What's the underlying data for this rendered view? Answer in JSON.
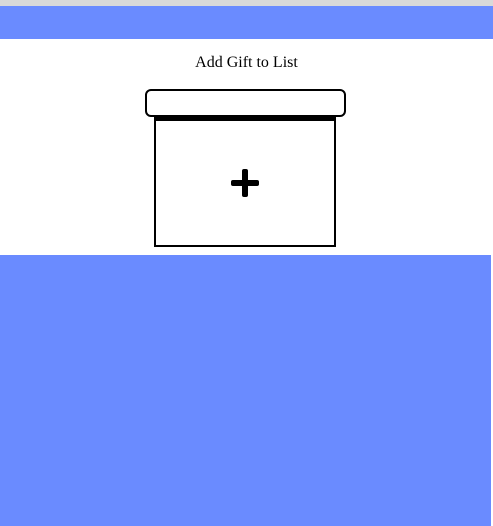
{
  "colors": {
    "accent": "#6a8bff",
    "background": "#ffffff",
    "stroke": "#000000",
    "top_line": "#d9d9d9"
  },
  "main": {
    "title": "Add Gift to List"
  },
  "add_gift": {
    "icon": "plus-icon"
  }
}
